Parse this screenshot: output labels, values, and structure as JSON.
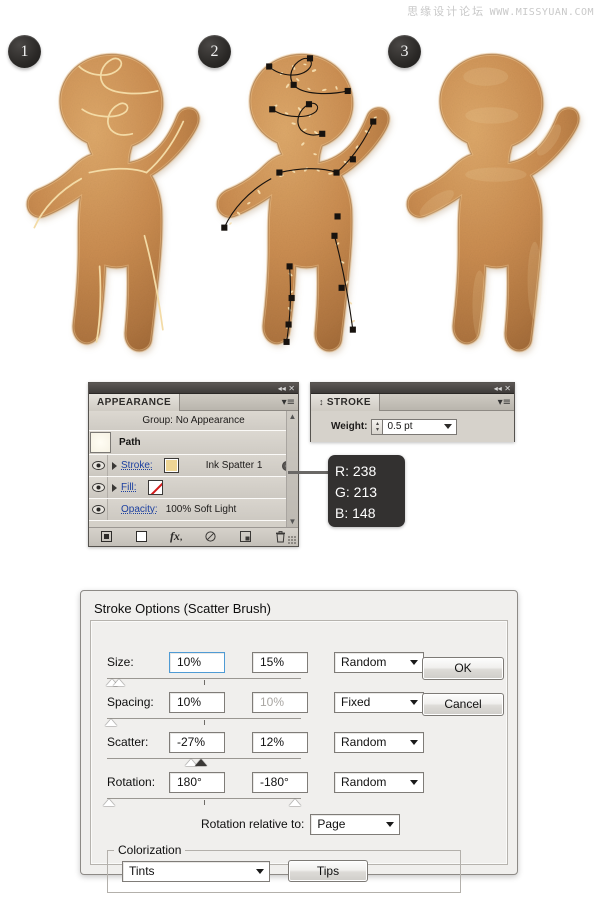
{
  "watermark": {
    "cn": "思缘设计论坛",
    "url": "WWW.MISSYUAN.COM"
  },
  "steps": [
    {
      "label": "1",
      "name": "step-1"
    },
    {
      "label": "2",
      "name": "step-2"
    },
    {
      "label": "3",
      "name": "step-3"
    }
  ],
  "appearance_panel": {
    "topbar_icons": "◂◂  ✕",
    "tab_label": "APPEARANCE",
    "menu_glyph": "▾≡",
    "group_row": "Group: No Appearance",
    "path_row": "Path",
    "stroke_label": "Stroke:",
    "stroke_swatch_color": "#eed594",
    "stroke_brush_name": "Ink Spatter 1",
    "fill_label": "Fill:",
    "fill_swatch": "none",
    "opacity_label": "Opacity:",
    "opacity_value": "100% Soft Light",
    "footer_icons": [
      {
        "name": "add-new-stroke-icon",
        "glyph": "■"
      },
      {
        "name": "add-new-fill-icon",
        "glyph": "□"
      },
      {
        "name": "add-new-effect-icon",
        "glyph": "fx"
      },
      {
        "name": "clear-appearance-icon",
        "glyph": "⊘"
      },
      {
        "name": "duplicate-item-icon",
        "glyph": "❐"
      },
      {
        "name": "delete-item-icon",
        "glyph": "🗑"
      }
    ],
    "scroll_up": "▲",
    "scroll_down": "▼"
  },
  "stroke_panel": {
    "topbar_icons": "◂◂  ✕",
    "tab_label": "STROKE",
    "menu_glyph": "▾≡",
    "weight_label": "Weight:",
    "weight_value": "0.5 pt",
    "stepper_up": "▴",
    "stepper_down": "▾"
  },
  "rgb_tooltip": {
    "r": "R: 238",
    "g": "G: 213",
    "b": "B: 148",
    "hex": "#eed594"
  },
  "dialog": {
    "title": "Stroke Options (Scatter Brush)",
    "rows": [
      {
        "name": "size",
        "label": "Size:",
        "value": "10%",
        "value2": "15%",
        "mode": "Random",
        "second_dim": false
      },
      {
        "name": "spacing",
        "label": "Spacing:",
        "value": "10%",
        "value2": "10%",
        "mode": "Fixed",
        "second_dim": true
      },
      {
        "name": "scatter",
        "label": "Scatter:",
        "value": "-27%",
        "value2": "12%",
        "mode": "Random",
        "second_dim": false
      },
      {
        "name": "rotation",
        "label": "Rotation:",
        "value": "180°",
        "value2": "-180°",
        "mode": "Random",
        "second_dim": false
      }
    ],
    "rotation_relative_label": "Rotation relative to:",
    "rotation_relative_value": "Page",
    "colorization_legend": "Colorization",
    "colorization_value": "Tints",
    "tips_button": "Tips",
    "ok_button": "OK",
    "cancel_button": "Cancel"
  },
  "colors": {
    "cookie_light": "#dfa869",
    "cookie_mid": "#c98b4e",
    "cookie_dark": "#a8703c",
    "cookie_edge": "#8e5c2e",
    "icing": "#f2d9a2",
    "path_line": "#16120f",
    "badge": "#2b2927"
  }
}
